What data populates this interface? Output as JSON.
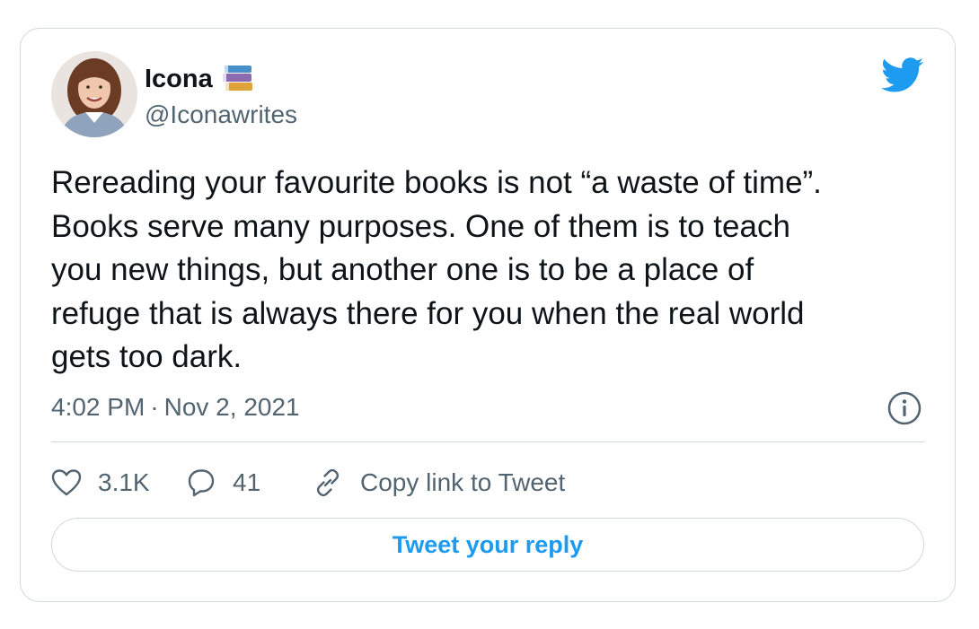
{
  "author": {
    "display_name": "Icona",
    "name_emoji_icon": "books-icon",
    "handle": "@Iconawrites",
    "avatar_icon": "avatar-photo"
  },
  "brand": {
    "icon": "twitter-bird-icon",
    "color": "#1d9bf0"
  },
  "tweet": {
    "text": "Rereading your favourite books is not “a waste of time”.\nBooks serve many purposes. One of them is to teach\nyou new things, but another one is to be a place of\nrefuge that is always there for you when the real world\ngets too dark.",
    "time": "4:02 PM",
    "separator": "·",
    "date": "Nov 2, 2021",
    "info_icon": "info-icon"
  },
  "actions": {
    "like": {
      "icon": "heart-icon",
      "count": "3.1K"
    },
    "reply": {
      "icon": "reply-bubble-icon",
      "count": "41"
    },
    "copy_link": {
      "icon": "link-icon",
      "label": "Copy link to Tweet"
    }
  },
  "reply_button": {
    "label": "Tweet your reply"
  },
  "colors": {
    "text": "#0f1419",
    "secondary": "#536471",
    "border": "#d3d8dc",
    "accent": "#1d9bf0"
  }
}
